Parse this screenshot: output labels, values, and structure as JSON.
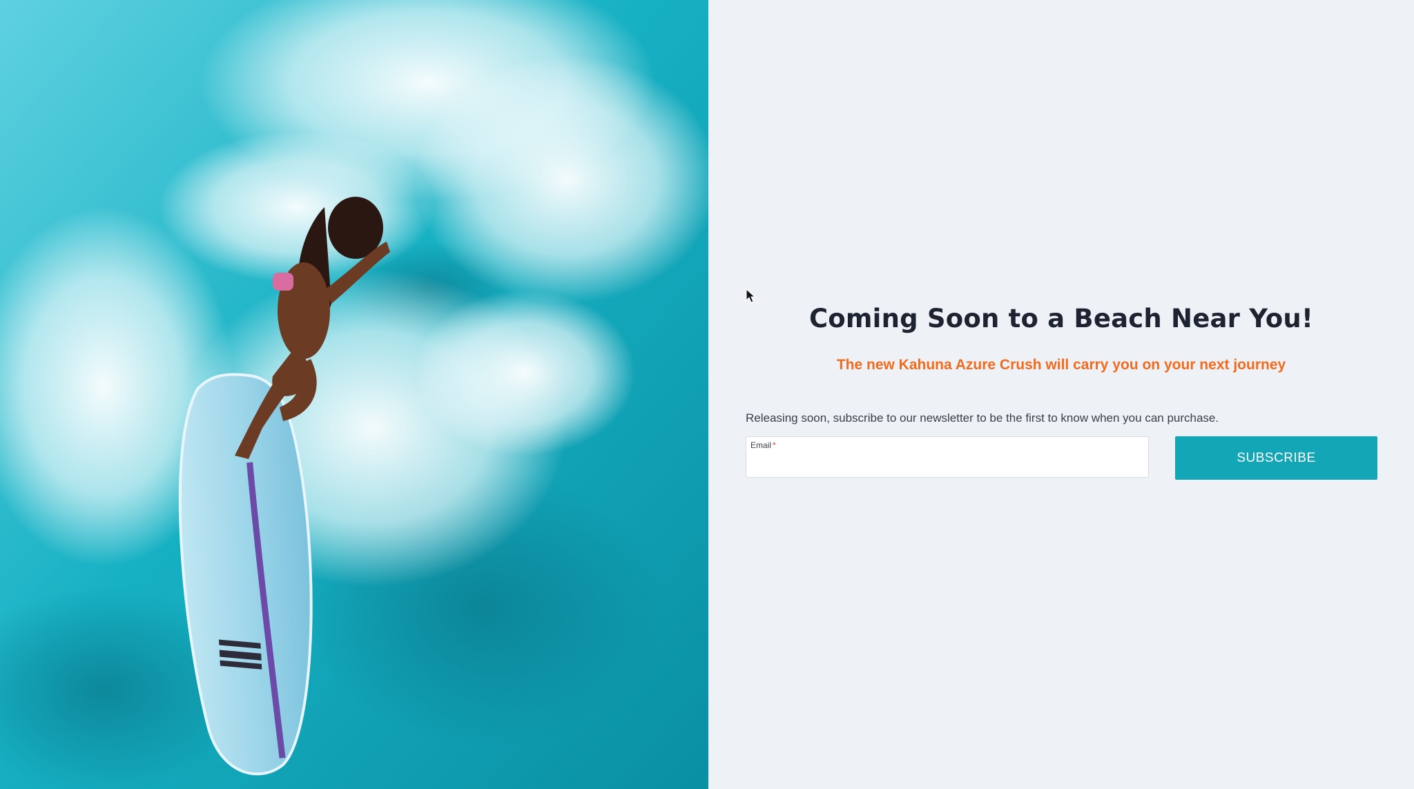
{
  "hero": {
    "image_icon": "surfer-photo",
    "brand_mark_icon": "billabong-logo-icon"
  },
  "main": {
    "title": "Coming Soon to a Beach Near You!",
    "subtitle": "The new Kahuna Azure Crush will carry you on your next journey",
    "description": "Releasing soon, subscribe to our newsletter to be the first to know when you can purchase.",
    "email": {
      "label": "Email",
      "required_mark": "*",
      "value": "",
      "placeholder": ""
    },
    "subscribe_label": "SUBSCRIBE"
  },
  "colors": {
    "accent": "#12a6b7",
    "subtitle": "#f26a1b",
    "heading": "#1d2330",
    "background": "#eef1f6"
  }
}
